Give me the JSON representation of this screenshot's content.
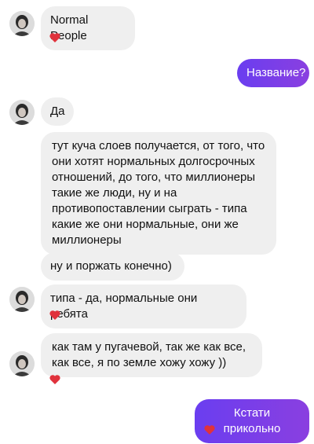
{
  "messages": [
    {
      "side": "in",
      "text": "Normal People",
      "reaction": "heart-icon"
    },
    {
      "side": "out",
      "text": "Название?"
    },
    {
      "side": "in",
      "text": "Да"
    },
    {
      "side": "in",
      "text": "тут куча слоев получается, от того, что они хотят нормальных долгосрочных отношений, до того, что миллионеры такие же люди, ну и на противопоставлении сыграть - типа какие же они нормальные, они же миллионеры"
    },
    {
      "side": "in",
      "text": "ну и поржать конечно)"
    },
    {
      "side": "in",
      "text": "типа - да, нормальные они ребята",
      "reaction": "heart-icon"
    },
    {
      "side": "in",
      "text": "как там у пугачевой, так же как все, как все, я по земле хожу хожу ))",
      "reaction": "heart-icon"
    },
    {
      "side": "out",
      "text": "Кстати прикольно",
      "reaction": "heart-icon"
    }
  ],
  "colors": {
    "incoming_bubble": "#efefef",
    "outgoing_bubble": "#7b3fe4",
    "heart": "#e0323c"
  }
}
